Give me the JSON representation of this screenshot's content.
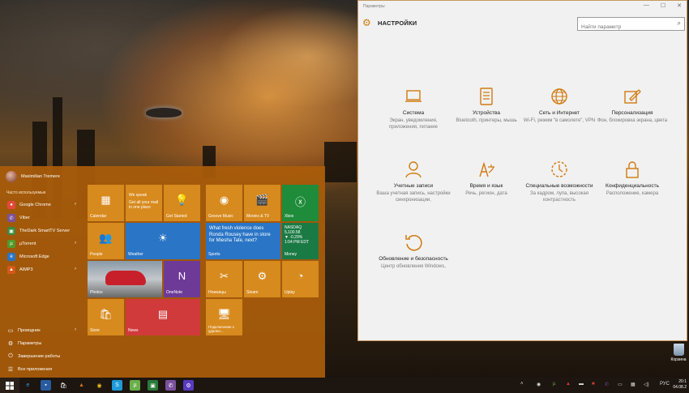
{
  "settings_window": {
    "window_title": "Параметры",
    "controls": [
      "—",
      "☐",
      "✕"
    ],
    "header_title": "НАСТРОЙКИ",
    "search_placeholder": "Найти параметр",
    "categories": [
      {
        "name": "Система",
        "desc": "Экран, уведомления, приложения, питание",
        "icon": "laptop-icon"
      },
      {
        "name": "Устройства",
        "desc": "Bluetooth, принтеры, мышь",
        "icon": "keyboard-icon"
      },
      {
        "name": "Сеть и Интернет",
        "desc": "Wi-Fi, режим \"в самолете\", VPN",
        "icon": "globe-icon"
      },
      {
        "name": "Персонализация",
        "desc": "Фон, блокировка экрана, цвета",
        "icon": "pen-icon"
      },
      {
        "name": "Учетные записи",
        "desc": "Ваша учетная запись, настройки синхронизации,",
        "icon": "person-icon"
      },
      {
        "name": "Время и язык",
        "desc": "Речь, регион, дата",
        "icon": "time-language-icon"
      },
      {
        "name": "Специальные возможности",
        "desc": "За кадром, лупа, высокая контрастность",
        "icon": "accessibility-icon"
      },
      {
        "name": "Конфиденциальность",
        "desc": "Расположение, камера",
        "icon": "lock-icon"
      },
      {
        "name": "Обновление и безопасность",
        "desc": "Центр обновления Windows,",
        "icon": "update-icon"
      }
    ]
  },
  "start_menu": {
    "user_name": "Maximilian Tremere",
    "most_used_label": "Часто используемые",
    "apps": [
      {
        "label": "Google Chrome",
        "color": "#e04a3a",
        "glyph": "●",
        "chevron": "›"
      },
      {
        "label": "Viber",
        "color": "#7b519d",
        "glyph": "✆",
        "chevron": ""
      },
      {
        "label": "TheDark SmartTV Server",
        "color": "#3c8a3c",
        "glyph": "▣",
        "chevron": ""
      },
      {
        "label": "µTorrent",
        "color": "#4f9a2a",
        "glyph": "µ",
        "chevron": "›"
      },
      {
        "label": "Microsoft Edge",
        "color": "#2a75c6",
        "glyph": "e",
        "chevron": ""
      },
      {
        "label": "AIMP3",
        "color": "#d45a1a",
        "glyph": "▲",
        "chevron": "›"
      }
    ],
    "system_items": [
      {
        "label": "Проводник",
        "glyph": "▭",
        "chevron": "›"
      },
      {
        "label": "Параметры",
        "glyph": "⚙",
        "chevron": ""
      },
      {
        "label": "Завершение работы",
        "glyph": "⏻",
        "chevron": ""
      },
      {
        "label": "Все приложения",
        "glyph": "☰",
        "chevron": ""
      }
    ],
    "tiles": {
      "calendar": "Calendar",
      "mail_top": "We speak",
      "mail_body": "Get all your mail in one place",
      "get_started": "Get Started",
      "groove": "Groove Music",
      "movies": "Movies & TV",
      "xbox": "Xbox",
      "people": "People",
      "weather": "Weather",
      "sports_headline": "What fresh violence does Ronda Rousey have in store for Miesha Tate, next?",
      "sports": "Sports",
      "money_ticker": "NASDAQ",
      "money_value": "5,100.58",
      "money_change": "▼ -0.29%",
      "money_time": "1:04 PM EDT",
      "money": "Money",
      "photos": "Photos",
      "onenote": "OneNote",
      "snipping": "Ножницы",
      "steam": "Steam",
      "uplay": "Uplay",
      "store": "Store",
      "news": "News",
      "remote": "Подключение к удален..."
    }
  },
  "desktop": {
    "recycle_bin": "Корзина"
  },
  "taskbar": {
    "language": "РУС",
    "time": "20:1",
    "date": "04.08.2"
  }
}
